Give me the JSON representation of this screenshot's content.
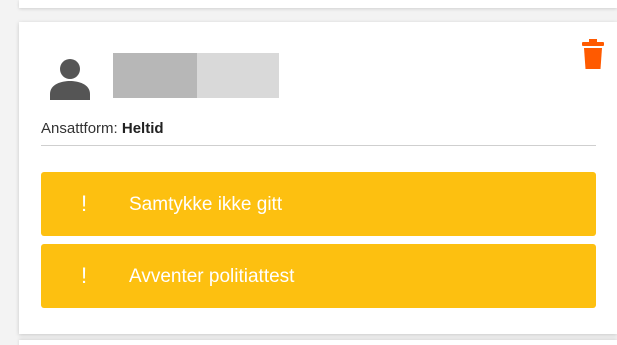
{
  "card": {
    "employment_label": "Ansattform:",
    "employment_value": "Heltid"
  },
  "alerts": [
    {
      "icon": "!",
      "text": "Samtykke ikke gitt"
    },
    {
      "icon": "!",
      "text": "Avventer politiattest"
    }
  ],
  "colors": {
    "alert_background": "#fdc010",
    "delete_icon": "#ff5a00",
    "avatar_icon": "#555555"
  },
  "icons": {
    "avatar": "person-icon",
    "delete": "trash-icon"
  }
}
